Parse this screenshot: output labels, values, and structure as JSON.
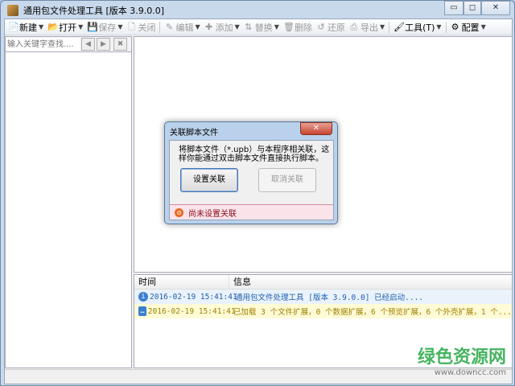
{
  "window": {
    "title": "通用包文件处理工具 [版本 3.9.0.0]",
    "minimize": "▭",
    "maximize": "◻",
    "close": "✕"
  },
  "toolbar": [
    {
      "label": "新建",
      "icon": "new-file-icon",
      "glyph": "📄",
      "dropdown": true,
      "disabled": false
    },
    {
      "label": "打开",
      "icon": "folder-open-icon",
      "glyph": "📂",
      "dropdown": true,
      "disabled": false
    },
    {
      "label": "保存",
      "icon": "save-icon",
      "glyph": "💾",
      "dropdown": true,
      "disabled": true
    },
    {
      "label": "关闭",
      "icon": "close-file-icon",
      "glyph": "🗋",
      "dropdown": false,
      "disabled": true
    },
    {
      "label": "编辑",
      "icon": "pencil-icon",
      "glyph": "✎",
      "dropdown": true,
      "disabled": true
    },
    {
      "label": "添加",
      "icon": "plus-icon",
      "glyph": "✚",
      "dropdown": true,
      "disabled": true
    },
    {
      "label": "替换",
      "icon": "replace-icon",
      "glyph": "⇅",
      "dropdown": true,
      "disabled": true
    },
    {
      "label": "删除",
      "icon": "delete-icon",
      "glyph": "🗑",
      "dropdown": false,
      "disabled": true
    },
    {
      "label": "还原",
      "icon": "restore-icon",
      "glyph": "↺",
      "dropdown": false,
      "disabled": true
    },
    {
      "label": "导出",
      "icon": "export-icon",
      "glyph": "⎙",
      "dropdown": true,
      "disabled": true
    },
    {
      "label": "工具(T)",
      "icon": "tool-icon",
      "glyph": "🖌",
      "dropdown": true,
      "disabled": false
    },
    {
      "label": "配置",
      "icon": "gear-icon",
      "glyph": "⚙",
      "dropdown": true,
      "disabled": false
    }
  ],
  "search": {
    "placeholder": "输入关键字查找....",
    "prev": "◀",
    "next": "▶",
    "clear": "✖"
  },
  "log": {
    "columns": [
      "时间",
      "信息"
    ],
    "rows": [
      {
        "type": "info",
        "time": "2016-02-19 15:41:41",
        "message": "通用包文件处理工具 [版本 3.9.0.0] 已经启动....",
        "color": "#1f5fae"
      },
      {
        "type": "message",
        "time": "2016-02-19 15:41:41",
        "message": "已加载 3 个文件扩展，0 个数据扩展，6 个预览扩展，6 个外壳扩展，1 个...",
        "color": "#a08000"
      }
    ]
  },
  "dialog": {
    "title": "关联脚本文件",
    "message": "将脚本文件（*.upb）与本程序相关联，这样你能通过双击脚本文件直接执行脚本。",
    "set_button": "设置关联",
    "cancel_button": "取消关联",
    "status": "尚未设置关联",
    "close": "✕"
  },
  "watermark": {
    "name": "绿色资源网",
    "url": "www.downcc.com"
  }
}
